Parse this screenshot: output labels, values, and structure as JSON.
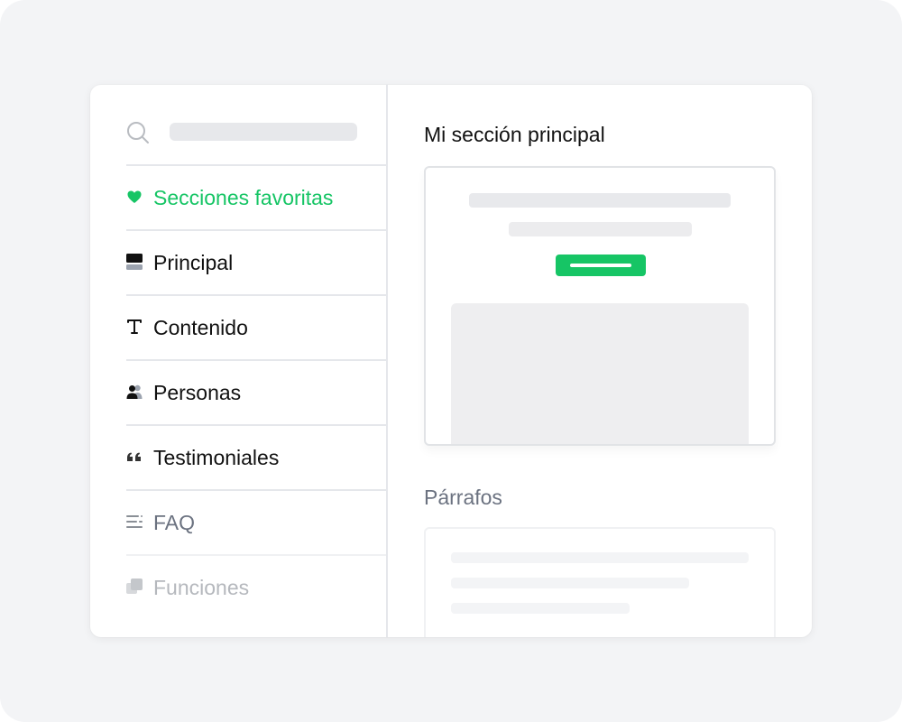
{
  "colors": {
    "accent": "#16c565",
    "text_primary": "#111111",
    "text_muted": "#6b7280",
    "text_faded": "#b5b8bd",
    "background": "#f3f4f6"
  },
  "sidebar": {
    "search_icon": "search-icon",
    "items": [
      {
        "label": "Secciones favoritas",
        "icon": "heart-icon",
        "state": "active"
      },
      {
        "label": "Principal",
        "icon": "header-layout-icon",
        "state": "normal"
      },
      {
        "label": "Contenido",
        "icon": "text-type-icon",
        "state": "normal"
      },
      {
        "label": "Personas",
        "icon": "people-icon",
        "state": "normal"
      },
      {
        "label": "Testimoniales",
        "icon": "quote-icon",
        "state": "normal"
      },
      {
        "label": "FAQ",
        "icon": "list-icon",
        "state": "muted"
      },
      {
        "label": "Funciones",
        "icon": "stacked-squares-icon",
        "state": "faded"
      }
    ]
  },
  "main": {
    "section_title": "Mi sección principal",
    "subsection_title": "Párrafos"
  }
}
